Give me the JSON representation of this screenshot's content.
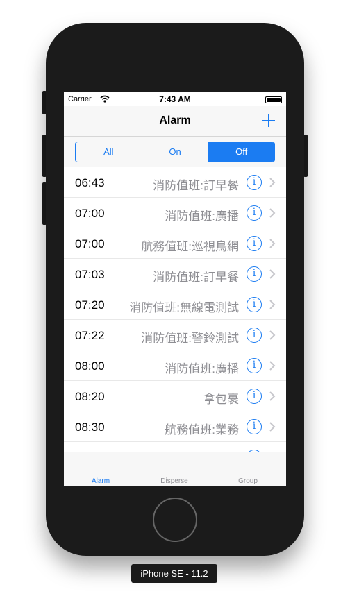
{
  "status_bar": {
    "carrier": "Carrier",
    "time": "7:43 AM"
  },
  "navbar": {
    "title": "Alarm",
    "add_icon": "plus-icon"
  },
  "segments": [
    {
      "label": "All",
      "active": false
    },
    {
      "label": "On",
      "active": false
    },
    {
      "label": "Off",
      "active": true
    }
  ],
  "alarms": [
    {
      "time": "06:43",
      "label": "消防值班:訂早餐"
    },
    {
      "time": "07:00",
      "label": "消防值班:廣播"
    },
    {
      "time": "07:00",
      "label": "航務值班:巡視鳥網"
    },
    {
      "time": "07:03",
      "label": "消防值班:訂早餐"
    },
    {
      "time": "07:20",
      "label": "消防值班:無線電測試"
    },
    {
      "time": "07:22",
      "label": "消防值班:警鈴測試"
    },
    {
      "time": "08:00",
      "label": "消防值班:廣播"
    },
    {
      "time": "08:20",
      "label": "拿包裹"
    },
    {
      "time": "08:30",
      "label": "航務值班:業務"
    }
  ],
  "tabs": [
    {
      "label": "Alarm",
      "active": true
    },
    {
      "label": "Disperse",
      "active": false
    },
    {
      "label": "Group",
      "active": false
    }
  ],
  "device_label": "iPhone SE - 11.2",
  "colors": {
    "accent": "#1b7cf2",
    "secondary_text": "#8e8e93",
    "device_body": "#1b1b1b"
  }
}
